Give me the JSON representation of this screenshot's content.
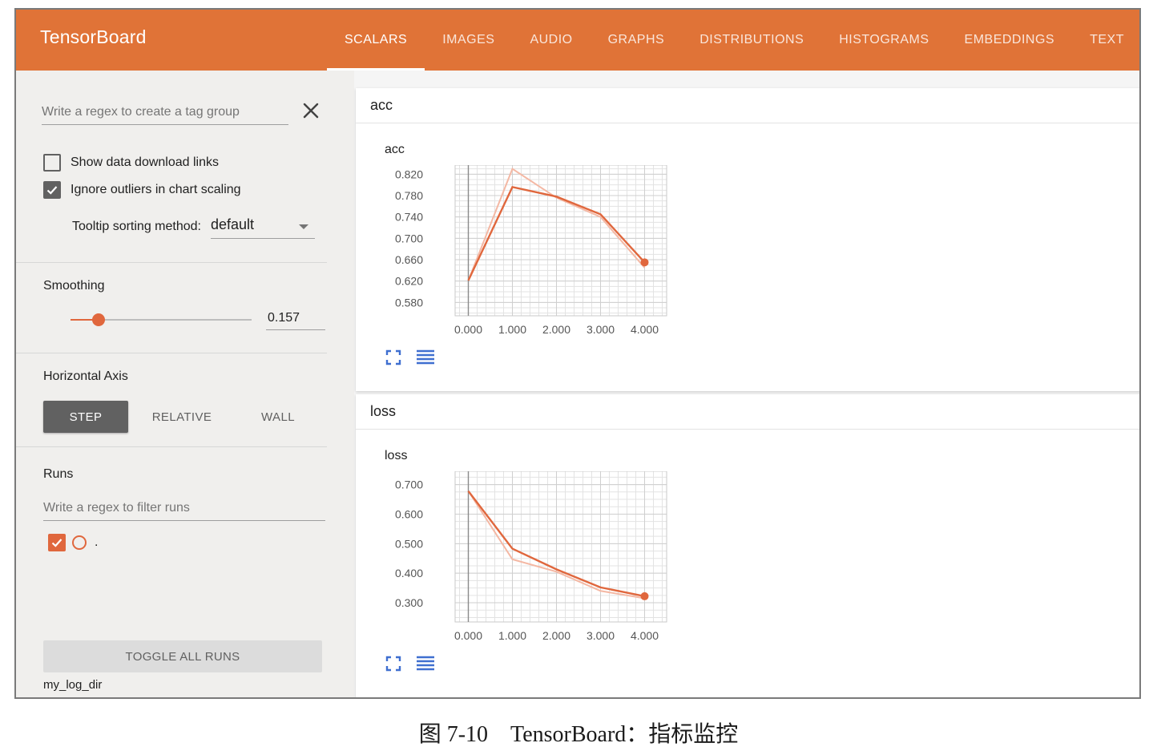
{
  "app": {
    "title": "TensorBoard"
  },
  "tabs": [
    {
      "label": "SCALARS",
      "active": true
    },
    {
      "label": "IMAGES"
    },
    {
      "label": "AUDIO"
    },
    {
      "label": "GRAPHS"
    },
    {
      "label": "DISTRIBUTIONS"
    },
    {
      "label": "HISTOGRAMS"
    },
    {
      "label": "EMBEDDINGS"
    },
    {
      "label": "TEXT"
    }
  ],
  "sidebar": {
    "tag_regex_placeholder": "Write a regex to create a tag group",
    "show_download_label": "Show data download links",
    "show_download_checked": false,
    "ignore_outliers_label": "Ignore outliers in chart scaling",
    "ignore_outliers_checked": true,
    "tooltip_label": "Tooltip sorting method:",
    "tooltip_value": "default",
    "smoothing_title": "Smoothing",
    "smoothing_value": "0.157",
    "smoothing_fraction": 0.157,
    "haxis_title": "Horizontal Axis",
    "haxis_options": [
      "STEP",
      "RELATIVE",
      "WALL"
    ],
    "haxis_selected": "STEP",
    "runs_title": "Runs",
    "runs_filter_placeholder": "Write a regex to filter runs",
    "run_name": ".",
    "toggle_all_label": "TOGGLE ALL RUNS",
    "logdir": "my_log_dir"
  },
  "cards": [
    {
      "header": "acc",
      "chart_title": "acc"
    },
    {
      "header": "loss",
      "chart_title": "loss"
    }
  ],
  "colors": {
    "accent": "#e07337",
    "series": "#e0673d",
    "series_raw": "#f4b8a4"
  },
  "chart_data": [
    {
      "type": "line",
      "title": "acc",
      "x": [
        0,
        1,
        2,
        3,
        4
      ],
      "x_tick_labels": [
        "0.000",
        "1.000",
        "2.000",
        "3.000",
        "4.000"
      ],
      "y_tick_values": [
        0.58,
        0.62,
        0.66,
        0.7,
        0.74,
        0.78,
        0.82
      ],
      "y_tick_labels": [
        "0.580",
        "0.620",
        "0.660",
        "0.700",
        "0.740",
        "0.780",
        "0.820"
      ],
      "ylim": [
        0.555,
        0.837
      ],
      "xlim": [
        -0.3,
        4.5
      ],
      "series": [
        {
          "role": "smoothed",
          "values": [
            0.621,
            0.796,
            0.778,
            0.745,
            0.655
          ]
        },
        {
          "role": "raw",
          "values": [
            0.621,
            0.83,
            0.776,
            0.74,
            0.645
          ]
        }
      ],
      "grid": true
    },
    {
      "type": "line",
      "title": "loss",
      "x": [
        0,
        1,
        2,
        3,
        4
      ],
      "x_tick_labels": [
        "0.000",
        "1.000",
        "2.000",
        "3.000",
        "4.000"
      ],
      "y_tick_values": [
        0.3,
        0.4,
        0.5,
        0.6,
        0.7
      ],
      "y_tick_labels": [
        "0.300",
        "0.400",
        "0.500",
        "0.600",
        "0.700"
      ],
      "ylim": [
        0.235,
        0.745
      ],
      "xlim": [
        -0.3,
        4.5
      ],
      "series": [
        {
          "role": "smoothed",
          "values": [
            0.678,
            0.483,
            0.413,
            0.352,
            0.322
          ]
        },
        {
          "role": "raw",
          "values": [
            0.678,
            0.447,
            0.405,
            0.34,
            0.315
          ]
        }
      ],
      "grid": true
    }
  ],
  "caption": "图 7-10　TensorBoard：指标监控"
}
